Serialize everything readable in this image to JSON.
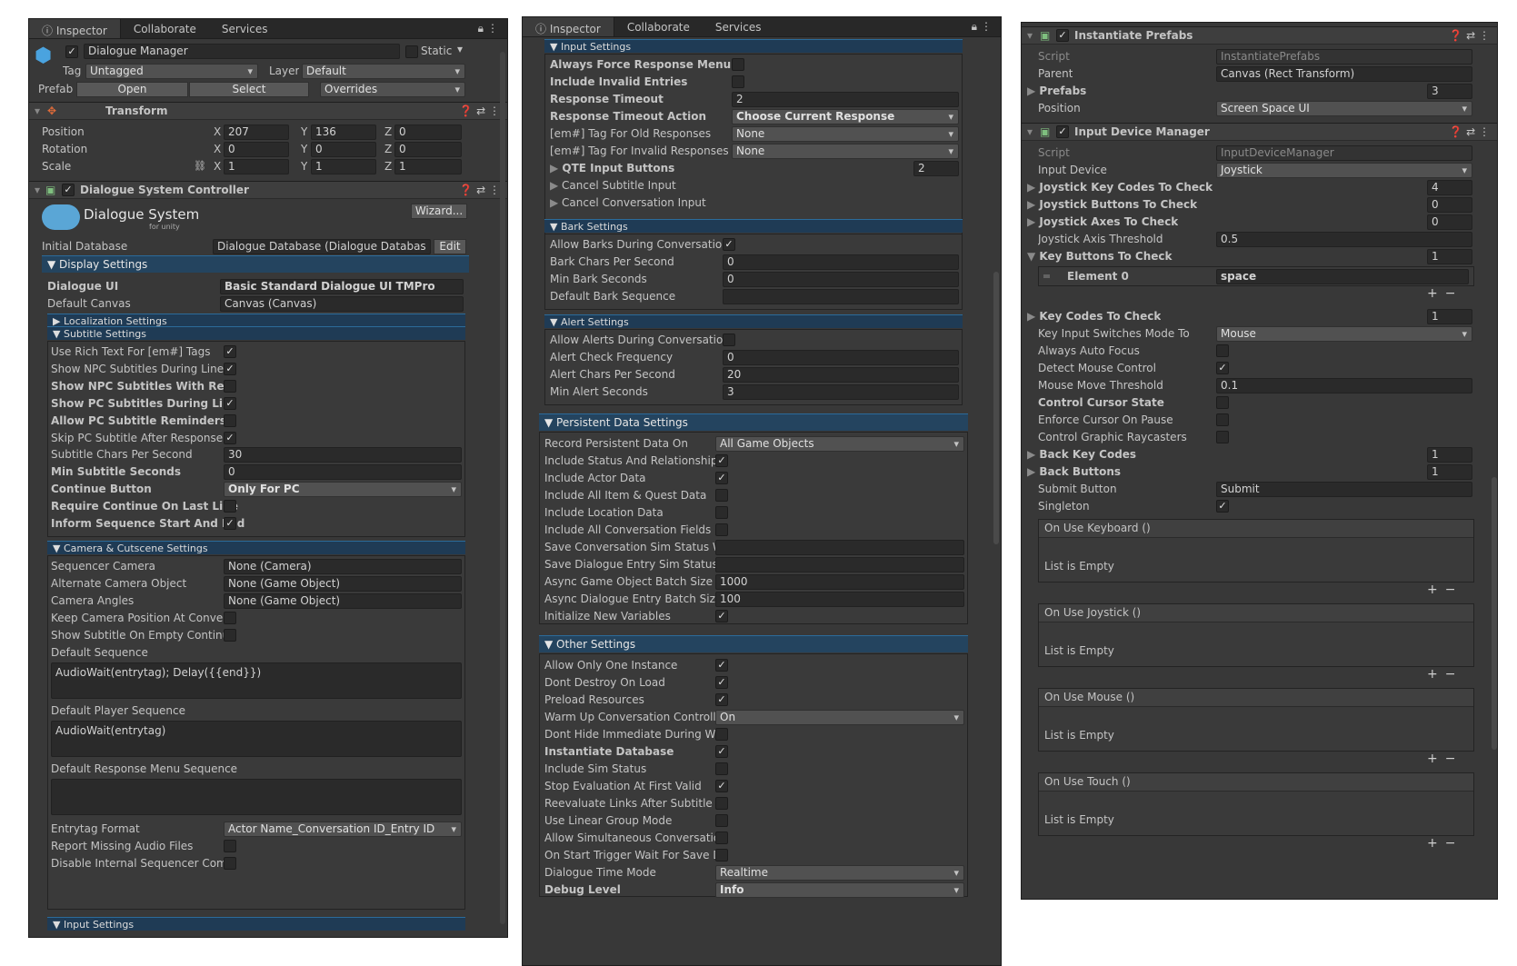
{
  "p1": {
    "tabs": [
      "Inspector",
      "Collaborate",
      "Services"
    ],
    "object_name": "Dialogue Manager",
    "static_label": "Static",
    "tag_label": "Tag",
    "tag_value": "Untagged",
    "layer_label": "Layer",
    "layer_value": "Default",
    "prefab_label": "Prefab",
    "prefab_open": "Open",
    "prefab_select": "Select",
    "prefab_overrides": "Overrides",
    "transform_title": "Transform",
    "position_label": "Position",
    "rotation_label": "Rotation",
    "scale_label": "Scale",
    "axes": [
      "X",
      "Y",
      "Z"
    ],
    "position": [
      "207",
      "136",
      "0"
    ],
    "rotation": [
      "0",
      "0",
      "0"
    ],
    "scale": [
      "1",
      "1",
      "1"
    ],
    "controller_title": "Dialogue System Controller",
    "logo_title": "Dialogue System",
    "logo_sub": "for unity",
    "wizard_btn": "Wizard...",
    "initial_db_label": "Initial Database",
    "initial_db_value": "Dialogue Database (Dialogue Databas",
    "edit_btn": "Edit",
    "display_settings": "Display Settings",
    "dialogue_ui_label": "Dialogue UI",
    "dialogue_ui_value": "Basic Standard Dialogue UI TMPro",
    "default_canvas_label": "Default Canvas",
    "default_canvas_value": "Canvas (Canvas)",
    "localization": "Localization Settings",
    "subtitle_settings": "Subtitle Settings",
    "sub_rows": [
      {
        "label": "Use Rich Text For [em#] Tags",
        "checked": true,
        "bold": false
      },
      {
        "label": "Show NPC Subtitles During Line",
        "checked": true,
        "bold": false
      },
      {
        "label": "Show NPC Subtitles With Respons",
        "checked": false,
        "bold": true
      },
      {
        "label": "Show PC Subtitles During Line",
        "checked": true,
        "bold": true
      },
      {
        "label": "Allow PC Subtitle Reminders",
        "checked": false,
        "bold": true
      },
      {
        "label": "Skip PC Subtitle After Response Me",
        "checked": true,
        "bold": false
      }
    ],
    "sub_chars_label": "Subtitle Chars Per Second",
    "sub_chars_value": "30",
    "min_sub_label": "Min Subtitle Seconds",
    "min_sub_value": "0",
    "continue_label": "Continue Button",
    "continue_value": "Only For PC",
    "require_continue": "Require Continue On Last Line",
    "inform_sequence": "Inform Sequence Start And End",
    "camera_settings": "Camera & Cutscene Settings",
    "seq_camera_label": "Sequencer Camera",
    "seq_camera_value": "None (Camera)",
    "alt_camera_label": "Alternate Camera Object",
    "alt_camera_value": "None (Game Object)",
    "camera_angles_label": "Camera Angles",
    "camera_angles_value": "None (Game Object)",
    "keep_camera": "Keep Camera Position At Conversat",
    "show_subtitle_empty": "Show Subtitle On Empty Continue",
    "default_sequence_label": "Default Sequence",
    "default_sequence_value": "AudioWait(entrytag); Delay({{end}})",
    "default_player_seq_label": "Default Player Sequence",
    "default_player_seq_value": "AudioWait(entrytag)",
    "default_response_seq_label": "Default Response Menu Sequence",
    "entrytag_label": "Entrytag Format",
    "entrytag_value": "Actor Name_Conversation ID_Entry ID",
    "report_missing": "Report Missing Audio Files",
    "disable_internal": "Disable Internal Sequencer Comma",
    "input_settings": "Input Settings"
  },
  "p2": {
    "tabs": [
      "Inspector",
      "Collaborate",
      "Services"
    ],
    "input_settings": "Input Settings",
    "always_force": "Always Force Response Menu",
    "include_invalid": "Include Invalid Entries",
    "response_timeout_label": "Response Timeout",
    "response_timeout_value": "2",
    "response_timeout_action_label": "Response Timeout Action",
    "response_timeout_action_value": "Choose Current Response",
    "tag_old_label": "[em#] Tag For Old Responses",
    "tag_old_value": "None",
    "tag_invalid_label": "[em#] Tag For Invalid Responses",
    "tag_invalid_value": "None",
    "qte_label": "QTE Input Buttons",
    "qte_value": "2",
    "cancel_subtitle": "Cancel Subtitle Input",
    "cancel_conversation": "Cancel Conversation Input",
    "bark_settings": "Bark Settings",
    "allow_barks": "Allow Barks During Conversations",
    "bark_chars_label": "Bark Chars Per Second",
    "bark_chars_value": "0",
    "min_bark_label": "Min Bark Seconds",
    "min_bark_value": "0",
    "default_bark_label": "Default Bark Sequence",
    "alert_settings": "Alert Settings",
    "allow_alerts": "Allow Alerts During Conversations",
    "alert_freq_label": "Alert Check Frequency",
    "alert_freq_value": "0",
    "alert_chars_label": "Alert Chars Per Second",
    "alert_chars_value": "20",
    "min_alert_label": "Min Alert Seconds",
    "min_alert_value": "3",
    "persistent_settings": "Persistent Data Settings",
    "record_label": "Record Persistent Data On",
    "record_value": "All Game Objects",
    "persist_rows": [
      {
        "label": "Include Status And Relationship Dat",
        "checked": true
      },
      {
        "label": "Include Actor Data",
        "checked": true
      },
      {
        "label": "Include All Item & Quest Data",
        "checked": false
      },
      {
        "label": "Include Location Data",
        "checked": false
      },
      {
        "label": "Include All Conversation Fields",
        "checked": false
      }
    ],
    "save_conv_label": "Save Conversation Sim Status With",
    "save_entry_label": "Save Dialogue Entry Sim Status Wit",
    "async_go_label": "Async Game Object Batch Size",
    "async_go_value": "1000",
    "async_de_label": "Async Dialogue Entry Batch Size",
    "async_de_value": "100",
    "init_vars": "Initialize New Variables",
    "other_settings": "Other Settings",
    "other_rows_a": [
      {
        "label": "Allow Only One Instance",
        "checked": true
      },
      {
        "label": "Dont Destroy On Load",
        "checked": true
      },
      {
        "label": "Preload Resources",
        "checked": true
      }
    ],
    "warmup_label": "Warm Up Conversation Controller",
    "warmup_value": "On",
    "other_rows_b": [
      {
        "label": "Dont Hide Immediate During Warmu",
        "checked": false,
        "bold": false
      },
      {
        "label": "Instantiate Database",
        "checked": true,
        "bold": true
      },
      {
        "label": "Include Sim Status",
        "checked": false,
        "bold": false
      },
      {
        "label": "Stop Evaluation At First Valid",
        "checked": true,
        "bold": false
      },
      {
        "label": "Reevaluate Links After Subtitle",
        "checked": false,
        "bold": false
      },
      {
        "label": "Use Linear Group Mode",
        "checked": false,
        "bold": false
      },
      {
        "label": "Allow Simultaneous Conversations",
        "checked": false,
        "bold": false
      },
      {
        "label": "On Start Trigger Wait For Save Data",
        "checked": false,
        "bold": false
      }
    ],
    "time_mode_label": "Dialogue Time Mode",
    "time_mode_value": "Realtime",
    "debug_label": "Debug Level",
    "debug_value": "Info"
  },
  "p3": {
    "instantiate_title": "Instantiate Prefabs",
    "script_label": "Script",
    "script_value_1": "InstantiatePrefabs",
    "parent_label": "Parent",
    "parent_value": "Canvas (Rect Transform)",
    "prefabs_label": "Prefabs",
    "prefabs_value": "3",
    "position_label": "Position",
    "position_value": "Screen Space UI",
    "idm_title": "Input Device Manager",
    "script_value_2": "InputDeviceManager",
    "input_device_label": "Input Device",
    "input_device_value": "Joystick",
    "jk_codes_label": "Joystick Key Codes To Check",
    "jk_codes_value": "4",
    "jb_label": "Joystick Buttons To Check",
    "jb_value": "0",
    "ja_label": "Joystick Axes To Check",
    "ja_value": "0",
    "jat_label": "Joystick Axis Threshold",
    "jat_value": "0.5",
    "kb_label": "Key Buttons To Check",
    "kb_value": "1",
    "element0_label": "Element 0",
    "element0_value": "space",
    "kc_label": "Key Codes To Check",
    "kc_value": "1",
    "kism_label": "Key Input Switches Mode To",
    "kism_value": "Mouse",
    "always_auto_focus": "Always Auto Focus",
    "detect_mouse": "Detect Mouse Control",
    "mmt_label": "Mouse Move Threshold",
    "mmt_value": "0.1",
    "control_cursor": "Control Cursor State",
    "enforce_cursor": "Enforce Cursor On Pause",
    "control_graphic": "Control Graphic Raycasters",
    "back_key_label": "Back Key Codes",
    "back_key_value": "1",
    "back_buttons_label": "Back Buttons",
    "back_buttons_value": "1",
    "submit_label": "Submit Button",
    "submit_value": "Submit",
    "singleton_label": "Singleton",
    "events": [
      "On Use Keyboard ()",
      "On Use Joystick ()",
      "On Use Mouse ()",
      "On Use Touch ()"
    ],
    "list_empty": "List is Empty"
  },
  "icons": {
    "check": "✓",
    "plus": "+",
    "minus": "−"
  }
}
